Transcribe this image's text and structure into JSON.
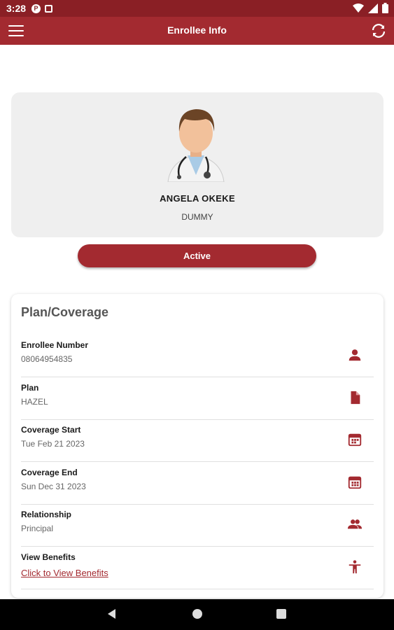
{
  "status_bar": {
    "time": "3:28",
    "badge": "P"
  },
  "app_bar": {
    "title": "Enrollee Info"
  },
  "profile": {
    "name": "ANGELA OKEKE",
    "subtitle": "DUMMY"
  },
  "status": {
    "label": "Active"
  },
  "coverage": {
    "title": "Plan/Coverage",
    "rows": [
      {
        "label": "Enrollee Number",
        "value": "08064954835",
        "icon": "person-icon"
      },
      {
        "label": "Plan",
        "value": "HAZEL",
        "icon": "document-icon"
      },
      {
        "label": "Coverage Start",
        "value": "Tue Feb 21 2023",
        "icon": "calendar-icon"
      },
      {
        "label": "Coverage End",
        "value": "Sun Dec 31 2023",
        "icon": "calendar-icon"
      },
      {
        "label": "Relationship",
        "value": "Principal",
        "icon": "people-icon"
      },
      {
        "label": "View Benefits",
        "value": "Click to View Benefits",
        "icon": "accessibility-icon"
      }
    ]
  },
  "colors": {
    "primary": "#a32a30",
    "status_bar": "#8a1f25",
    "card_bg": "#efefef"
  }
}
